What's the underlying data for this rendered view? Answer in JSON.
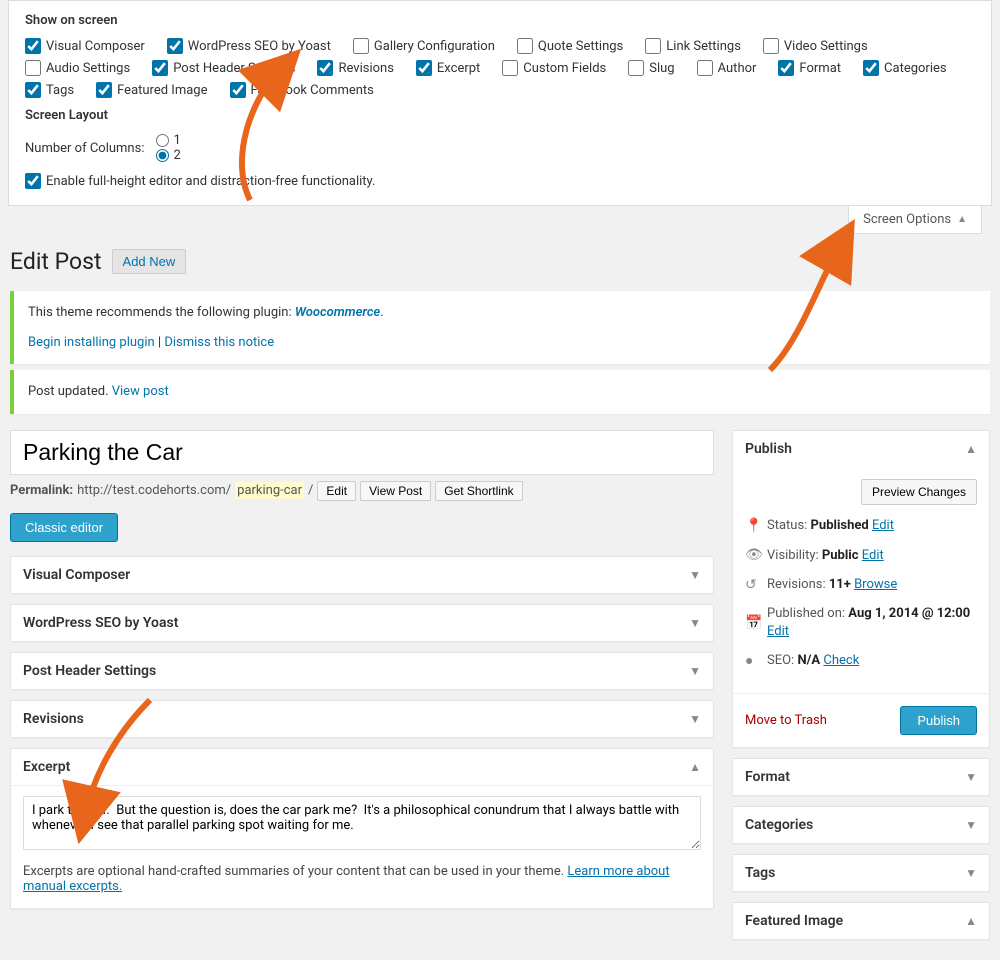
{
  "screenOptions": {
    "heading": "Show on screen",
    "checkboxes": [
      {
        "label": "Visual Composer",
        "checked": true
      },
      {
        "label": "WordPress SEO by Yoast",
        "checked": true
      },
      {
        "label": "Gallery Configuration",
        "checked": false
      },
      {
        "label": "Quote Settings",
        "checked": false
      },
      {
        "label": "Link Settings",
        "checked": false
      },
      {
        "label": "Video Settings",
        "checked": false
      },
      {
        "label": "Audio Settings",
        "checked": false
      },
      {
        "label": "Post Header Settings",
        "checked": true
      },
      {
        "label": "Revisions",
        "checked": true
      },
      {
        "label": "Excerpt",
        "checked": true
      },
      {
        "label": "Custom Fields",
        "checked": false
      },
      {
        "label": "Slug",
        "checked": false
      },
      {
        "label": "Author",
        "checked": false
      },
      {
        "label": "Format",
        "checked": true
      },
      {
        "label": "Categories",
        "checked": true
      },
      {
        "label": "Tags",
        "checked": true
      },
      {
        "label": "Featured Image",
        "checked": true
      },
      {
        "label": "Facebook Comments",
        "checked": true
      }
    ],
    "layoutHeading": "Screen Layout",
    "columnsLabel": "Number of Columns:",
    "columns": [
      "1",
      "2"
    ],
    "selectedColumn": "2",
    "fullHeight": {
      "label": "Enable full-height editor and distraction-free functionality.",
      "checked": true
    },
    "tabLabel": "Screen Options"
  },
  "header": {
    "title": "Edit Post",
    "addNew": "Add New"
  },
  "notices": {
    "plugin": {
      "prefix": "This theme recommends the following plugin: ",
      "name": "Woocommerce",
      "install": "Begin installing plugin",
      "sep": " | ",
      "dismiss": "Dismiss this notice"
    },
    "updated": {
      "text": "Post updated. ",
      "link": "View post"
    }
  },
  "post": {
    "title": "Parking the Car",
    "permalinkLabel": "Permalink:",
    "permalinkBase": "http://test.codehorts.com/",
    "permalinkSlug": "parking-car",
    "permalinkTrail": "/",
    "editBtn": "Edit",
    "viewPostBtn": "View Post",
    "shortlinkBtn": "Get Shortlink",
    "classicEditor": "Classic editor"
  },
  "metaboxes": {
    "visualComposer": "Visual Composer",
    "seo": "WordPress SEO by Yoast",
    "postHeader": "Post Header Settings",
    "revisions": "Revisions",
    "excerpt": {
      "title": "Excerpt",
      "value": "I park the car.  But the question is, does the car park me?  It's a philosophical conundrum that I always battle with whenever I see that parallel parking spot waiting for me.",
      "helpPrefix": "Excerpts are optional hand-crafted summaries of your content that can be used in your theme. ",
      "helpLink": "Learn more about manual excerpts."
    }
  },
  "publish": {
    "title": "Publish",
    "preview": "Preview Changes",
    "statusLabel": "Status: ",
    "statusValue": "Published",
    "visibilityLabel": "Visibility: ",
    "visibilityValue": "Public",
    "revisionsLabel": "Revisions: ",
    "revisionsValue": "11+",
    "browseLink": "Browse",
    "publishedLabel": "Published on: ",
    "publishedValue": "Aug 1, 2014 @ 12:00",
    "seoLabel": "SEO: ",
    "seoValue": "N/A",
    "checkLink": "Check",
    "editLink": "Edit",
    "trash": "Move to Trash",
    "publishBtn": "Publish"
  },
  "sideBoxes": {
    "format": "Format",
    "categories": "Categories",
    "tags": "Tags",
    "featured": "Featured Image"
  }
}
